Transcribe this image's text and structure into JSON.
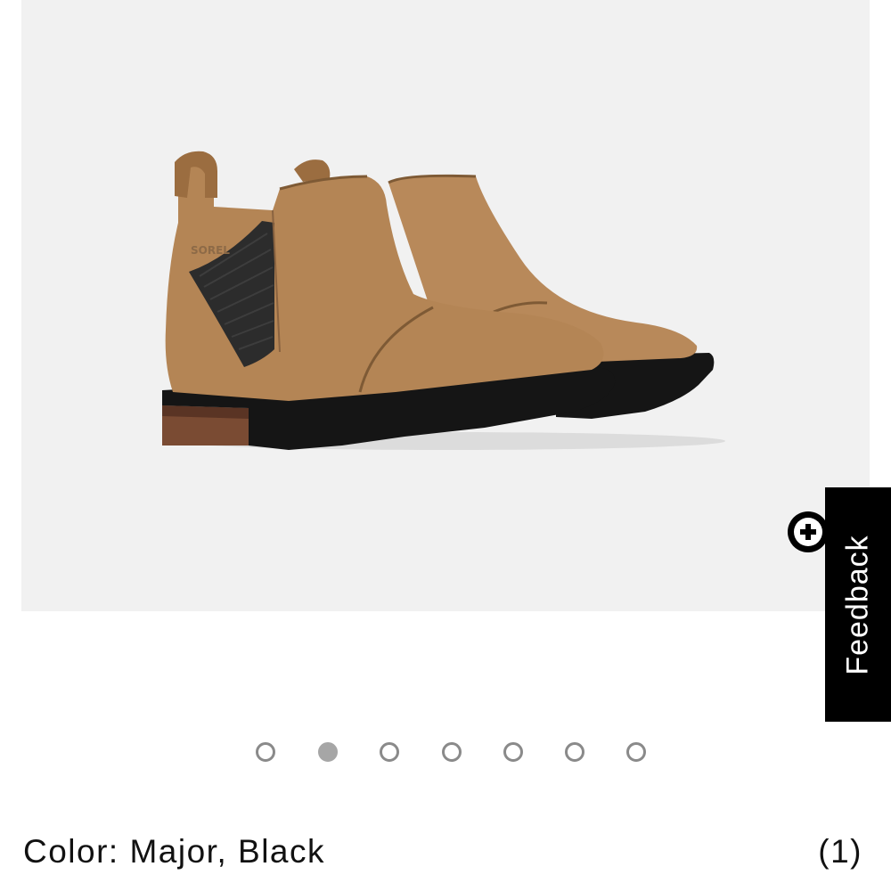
{
  "product": {
    "image_alt": "SOREL",
    "image_icon": "ankle-boot-product-photo",
    "boot_color": "#b08253",
    "background_color": "#f1f1f1"
  },
  "feedback": {
    "label": "Feedback",
    "icon": "plus-circle-icon"
  },
  "carousel": {
    "count": 7,
    "active_index": 1
  },
  "color": {
    "label": "Color: Major, Black"
  },
  "reviews": {
    "count_label": "(1)"
  }
}
